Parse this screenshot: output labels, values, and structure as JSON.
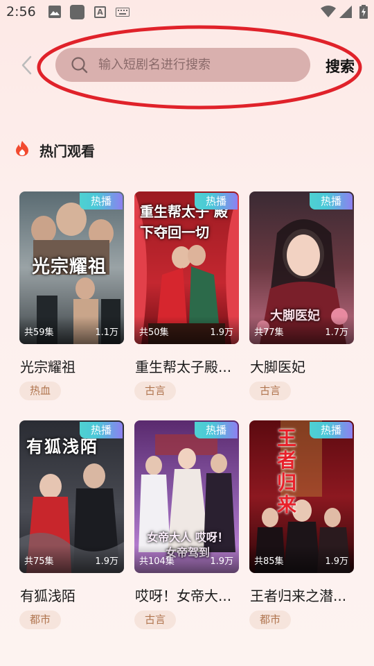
{
  "status_bar": {
    "time": "2:56",
    "icons": [
      "photo-icon",
      "app-square-icon",
      "a-icon",
      "keyboard-icon",
      "wifi-icon",
      "signal-icon",
      "battery-charging-icon"
    ]
  },
  "search": {
    "placeholder": "输入短剧名进行搜索",
    "value": "",
    "button_label": "搜索"
  },
  "section": {
    "title": "热门观看",
    "icon": "fire-icon"
  },
  "colors": {
    "search_bg": "#d9b0ae",
    "badge_gradient": [
      "#4fd1d1",
      "#8d7ff0"
    ],
    "tag_bg": "#f6e4dc",
    "tag_text": "#b0754f",
    "annotation": "#e0222a"
  },
  "cards": [
    {
      "badge": "热播",
      "poster_text": "光宗耀祖",
      "episodes": "共59集",
      "views": "1.1万",
      "title": "光宗耀祖",
      "tag": "热血"
    },
    {
      "badge": "热播",
      "poster_text": "重生帮太子 殿下夺回一切",
      "episodes": "共50集",
      "views": "1.9万",
      "title": "重生帮太子殿...",
      "tag": "古言"
    },
    {
      "badge": "热播",
      "poster_text": "大脚医妃",
      "episodes": "共77集",
      "views": "1.7万",
      "title": "大脚医妃",
      "tag": "古言"
    },
    {
      "badge": "热播",
      "poster_text": "有狐浅陌",
      "episodes": "共75集",
      "views": "1.9万",
      "title": "有狐浅陌",
      "tag": "都市"
    },
    {
      "badge": "热播",
      "poster_text": "女帝大人 哎呀！女帝驾到",
      "episodes": "共104集",
      "views": "1.9万",
      "title": "哎呀！女帝大...",
      "tag": "古言"
    },
    {
      "badge": "热播",
      "poster_text": "王者归来",
      "episodes": "共85集",
      "views": "1.9万",
      "title": "王者归来之潜...",
      "tag": "都市"
    }
  ]
}
